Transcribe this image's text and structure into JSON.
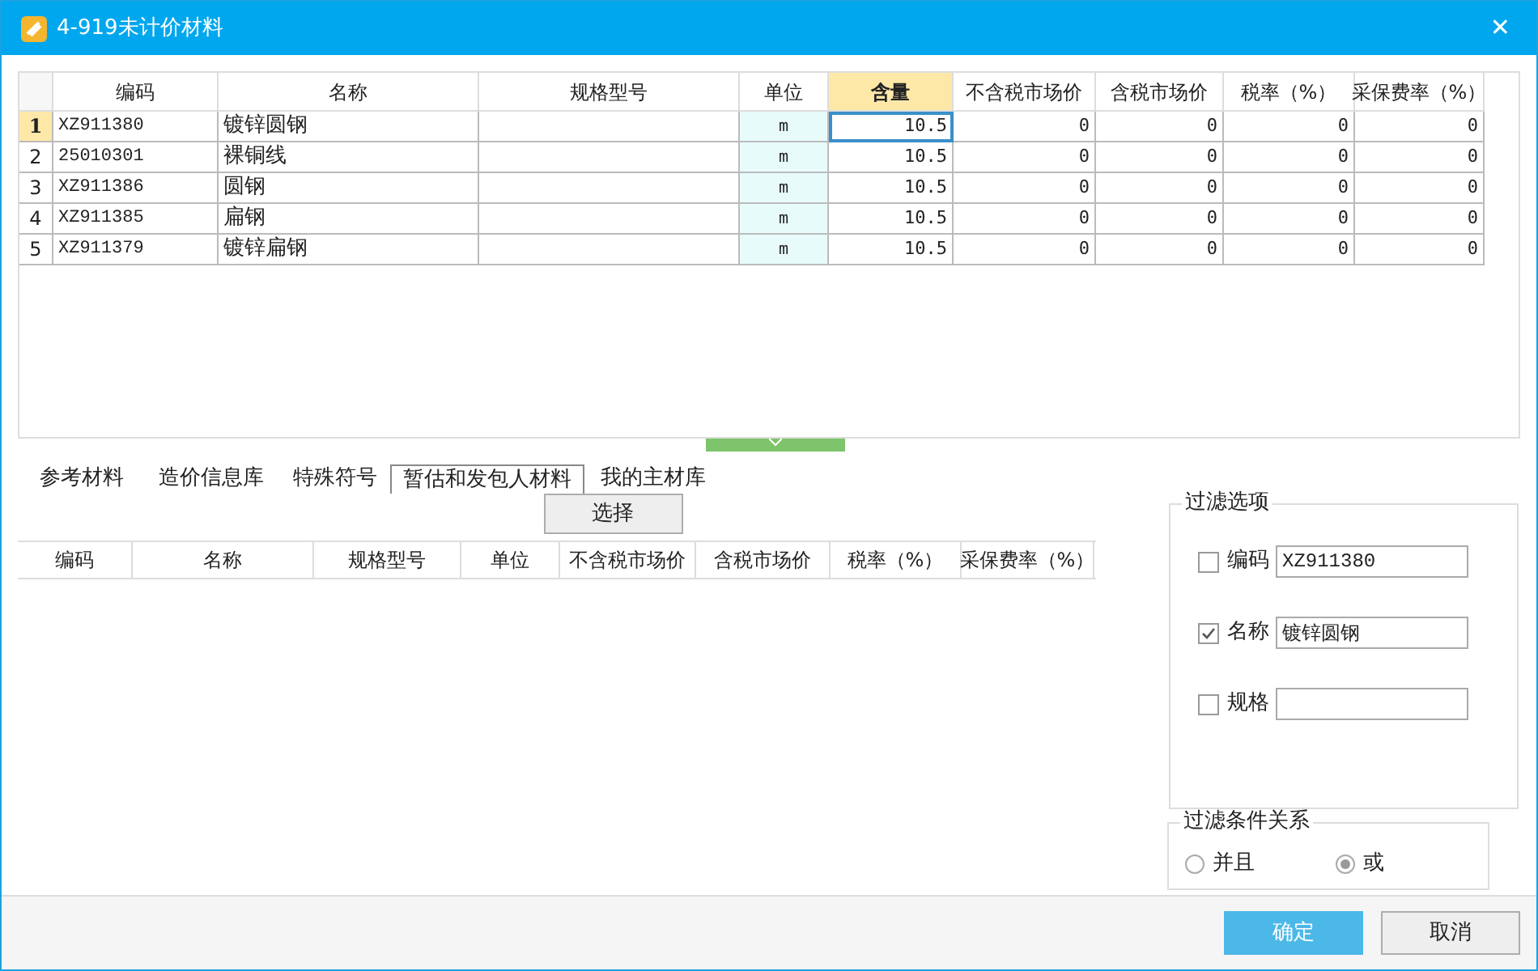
{
  "window": {
    "title": "4-919未计价材料",
    "close": "✕"
  },
  "table": {
    "columns": [
      {
        "label": "编码",
        "selected": false
      },
      {
        "label": "名称",
        "selected": false
      },
      {
        "label": "规格型号",
        "selected": false
      },
      {
        "label": "单位",
        "selected": false
      },
      {
        "label": "含量",
        "selected": true
      },
      {
        "label": "不含税市场价",
        "selected": false
      },
      {
        "label": "含税市场价",
        "selected": false
      },
      {
        "label": "税率（%）",
        "selected": false
      },
      {
        "label": "采保费率（%）",
        "selected": false
      }
    ],
    "rows": [
      {
        "index": "1",
        "selected": true,
        "cells": [
          "XZ911380",
          "镀锌圆钢",
          "",
          "m",
          "10.5",
          "0",
          "0",
          "0",
          "0"
        ]
      },
      {
        "index": "2",
        "selected": false,
        "cells": [
          "25010301",
          "裸铜线",
          "",
          "m",
          "10.5",
          "0",
          "0",
          "0",
          "0"
        ]
      },
      {
        "index": "3",
        "selected": false,
        "cells": [
          "XZ911386",
          "圆钢",
          "",
          "m",
          "10.5",
          "0",
          "0",
          "0",
          "0"
        ]
      },
      {
        "index": "4",
        "selected": false,
        "cells": [
          "XZ911385",
          "扁钢",
          "",
          "m",
          "10.5",
          "0",
          "0",
          "0",
          "0"
        ]
      },
      {
        "index": "5",
        "selected": false,
        "cells": [
          "XZ911379",
          "镀锌扁钢",
          "",
          "m",
          "10.5",
          "0",
          "0",
          "0",
          "0"
        ]
      }
    ]
  },
  "tabs": [
    {
      "label": "参考材料",
      "selected": false
    },
    {
      "label": "造价信息库",
      "selected": false
    },
    {
      "label": "特殊符号",
      "selected": false
    },
    {
      "label": "暂估和发包人材料",
      "selected": true
    },
    {
      "label": "我的主材库",
      "selected": false
    }
  ],
  "select_button": "选择",
  "lower_table": {
    "columns": [
      "编码",
      "名称",
      "规格型号",
      "单位",
      "不含税市场价",
      "含税市场价",
      "税率（%）",
      "采保费率（%）"
    ]
  },
  "filter_options": {
    "title": "过滤选项",
    "items": [
      {
        "label": "编码",
        "checked": false,
        "value": "XZ911380"
      },
      {
        "label": "名称",
        "checked": true,
        "value": "镀锌圆钢"
      },
      {
        "label": "规格",
        "checked": false
      }
    ]
  },
  "filter_relation": {
    "title": "过滤条件关系",
    "options": [
      {
        "label": "并且",
        "selected": false
      },
      {
        "label": "或",
        "selected": true
      }
    ]
  },
  "buttons": [
    {
      "label": "确定",
      "kind": "primary"
    },
    {
      "label": "取消",
      "kind": "default"
    }
  ]
}
